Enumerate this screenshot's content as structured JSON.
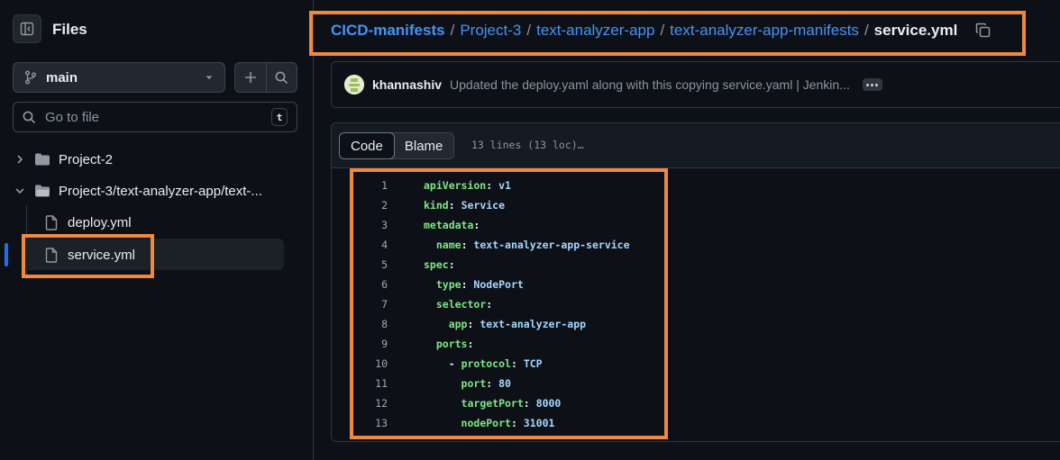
{
  "sidebar": {
    "title": "Files",
    "branch": "main",
    "goto_placeholder": "Go to file",
    "goto_shortcut": "t",
    "tree": [
      {
        "label": "Project-2",
        "type": "folder",
        "expanded": false
      },
      {
        "label": "Project-3/text-analyzer-app/text-...",
        "type": "folder",
        "expanded": true
      },
      {
        "label": "deploy.yml",
        "type": "file"
      },
      {
        "label": "service.yml",
        "type": "file",
        "selected": true
      }
    ]
  },
  "breadcrumb": {
    "repo": "CICD-manifests",
    "path": [
      "Project-3",
      "text-analyzer-app",
      "text-analyzer-app-manifests"
    ],
    "separator": "/",
    "file": "service.yml"
  },
  "commit": {
    "author": "khannashiv",
    "message": "Updated the deploy.yaml along with this copying service.yaml | Jenkin..."
  },
  "code_view": {
    "tabs": [
      "Code",
      "Blame"
    ],
    "active_tab": "Code",
    "loc_info": "13 lines (13 loc)…",
    "lines": [
      {
        "n": "1",
        "indent": "",
        "dash": "",
        "key": "apiVersion",
        "value": "v1"
      },
      {
        "n": "2",
        "indent": "",
        "dash": "",
        "key": "kind",
        "value": "Service"
      },
      {
        "n": "3",
        "indent": "",
        "dash": "",
        "key": "metadata",
        "value": ""
      },
      {
        "n": "4",
        "indent": "  ",
        "dash": "",
        "key": "name",
        "value": "text-analyzer-app-service"
      },
      {
        "n": "5",
        "indent": "",
        "dash": "",
        "key": "spec",
        "value": ""
      },
      {
        "n": "6",
        "indent": "  ",
        "dash": "",
        "key": "type",
        "value": "NodePort"
      },
      {
        "n": "7",
        "indent": "  ",
        "dash": "",
        "key": "selector",
        "value": ""
      },
      {
        "n": "8",
        "indent": "    ",
        "dash": "",
        "key": "app",
        "value": "text-analyzer-app"
      },
      {
        "n": "9",
        "indent": "  ",
        "dash": "",
        "key": "ports",
        "value": ""
      },
      {
        "n": "10",
        "indent": "    ",
        "dash": "- ",
        "key": "protocol",
        "value": "TCP"
      },
      {
        "n": "11",
        "indent": "      ",
        "dash": "",
        "key": "port",
        "value": "80"
      },
      {
        "n": "12",
        "indent": "      ",
        "dash": "",
        "key": "targetPort",
        "value": "8000"
      },
      {
        "n": "13",
        "indent": "      ",
        "dash": "",
        "key": "nodePort",
        "value": "31001"
      }
    ]
  },
  "colors": {
    "highlight_box": "#f0883e",
    "link": "#4493f8",
    "yaml_key": "#7ee787",
    "yaml_value": "#a5d6ff"
  },
  "icons": [
    "sidebar-collapse-icon",
    "git-branch-icon",
    "triangle-down-icon",
    "plus-icon",
    "search-icon",
    "folder-icon",
    "file-icon",
    "chevron-right-icon",
    "chevron-down-icon",
    "copy-icon",
    "kebab-horizontal-icon"
  ]
}
